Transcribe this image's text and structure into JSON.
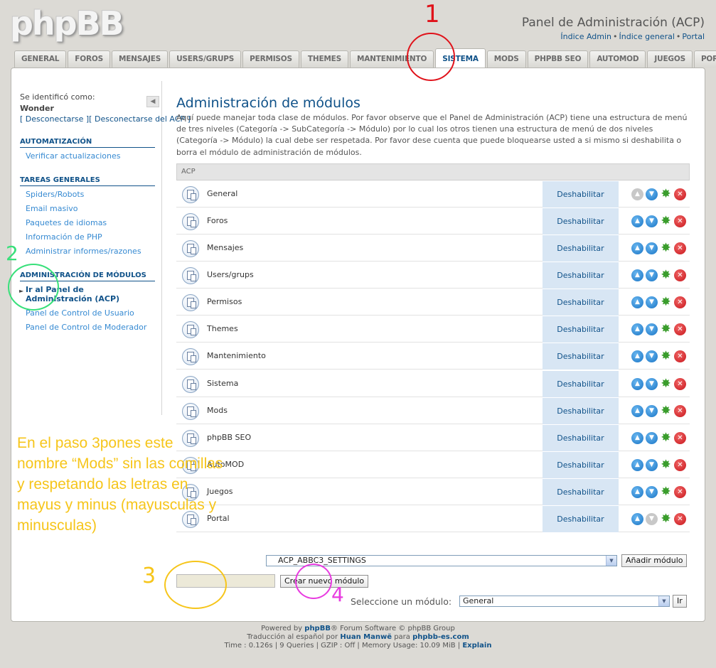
{
  "header": {
    "logo": "phpBB",
    "title": "Panel de Administración (ACP)",
    "links": [
      "Índice Admin",
      "Índice general",
      "Portal"
    ]
  },
  "tabs": [
    "GENERAL",
    "FOROS",
    "MENSAJES",
    "USERS/GRUPS",
    "PERMISOS",
    "THEMES",
    "MANTENIMIENTO",
    "SISTEMA",
    "MODS",
    "PHPBB SEO",
    "AUTOMOD",
    "JUEGOS",
    "PORTAL"
  ],
  "active_tab": "SISTEMA",
  "sidebar": {
    "identified_label": "Se identificó como:",
    "username": "Wonder",
    "logout_links": "[ Desconectarse ][ Desconectarse del ACP ]",
    "collapse_icon": "◀",
    "sections": [
      {
        "title": "AUTOMATIZACIÓN",
        "items": [
          "Verificar actualizaciones"
        ]
      },
      {
        "title": "TAREAS GENERALES",
        "items": [
          "Spiders/Robots",
          "Email masivo",
          "Paquetes de idiomas",
          "Información de PHP",
          "Administrar informes/razones"
        ]
      },
      {
        "title": "ADMINISTRACIÓN DE MÓDULOS",
        "items": [
          "Ir al Panel de Administración (ACP)",
          "Panel de Control de Usuario",
          "Panel de Control de Moderador"
        ]
      }
    ]
  },
  "content": {
    "title": "Administración de módulos",
    "intro": "Aquí puede manejar toda clase de módulos. Por favor observe que el Panel de Administración (ACP) tiene una estructura de menú de tres niveles (Categoría -> SubCategoría -> Módulo) por lo cual los otros tienen una estructura de menú de dos niveles (Categoría -> Módulo) la cual debe ser respetada. Por favor dese cuenta que puede bloquearse usted a si mismo si deshabilita o borra el módulo de administración de módulos.",
    "table_header": "ACP",
    "disable_label": "Deshabilitar",
    "modules": [
      "General",
      "Foros",
      "Mensajes",
      "Users/grups",
      "Permisos",
      "Themes",
      "Mantenimiento",
      "Sistema",
      "Mods",
      "phpBB SEO",
      "AutoMOD",
      "Juegos",
      "Portal"
    ]
  },
  "controls": {
    "add_module_select": "ACP_ABBC3_SETTINGS",
    "add_module_button": "Añadir módulo",
    "module_name_value": "",
    "create_button": "Crear nuevo módulo",
    "select_module_label": "Seleccione un módulo:",
    "select_module_value": "General",
    "go_button": "Ir"
  },
  "footer": {
    "line1_a": "Powered by ",
    "line1_link": "phpBB",
    "line1_b": "® Forum Software © phpBB Group",
    "line2_a": "Traducción al español por ",
    "line2_link1": "Huan Manwë",
    "line2_mid": " para ",
    "line2_link2": "phpbb-es.com",
    "line3": "Time : 0.126s | 9 Queries | GZIP : Off | Memory Usage: 10.09 MiB | ",
    "line3_link": "Explain"
  },
  "annotations": {
    "num1": "1",
    "num2": "2",
    "num3": "3",
    "num4": "4",
    "text": "En el paso 3pones este nombre “Mods” sin las comillas y respetando las letras en mayus y minus (mayusculas y minusculas)",
    "colors": {
      "red": "#e0121a",
      "green": "#38e07a",
      "yellow": "#f6c51a",
      "magenta": "#e83be0"
    }
  }
}
